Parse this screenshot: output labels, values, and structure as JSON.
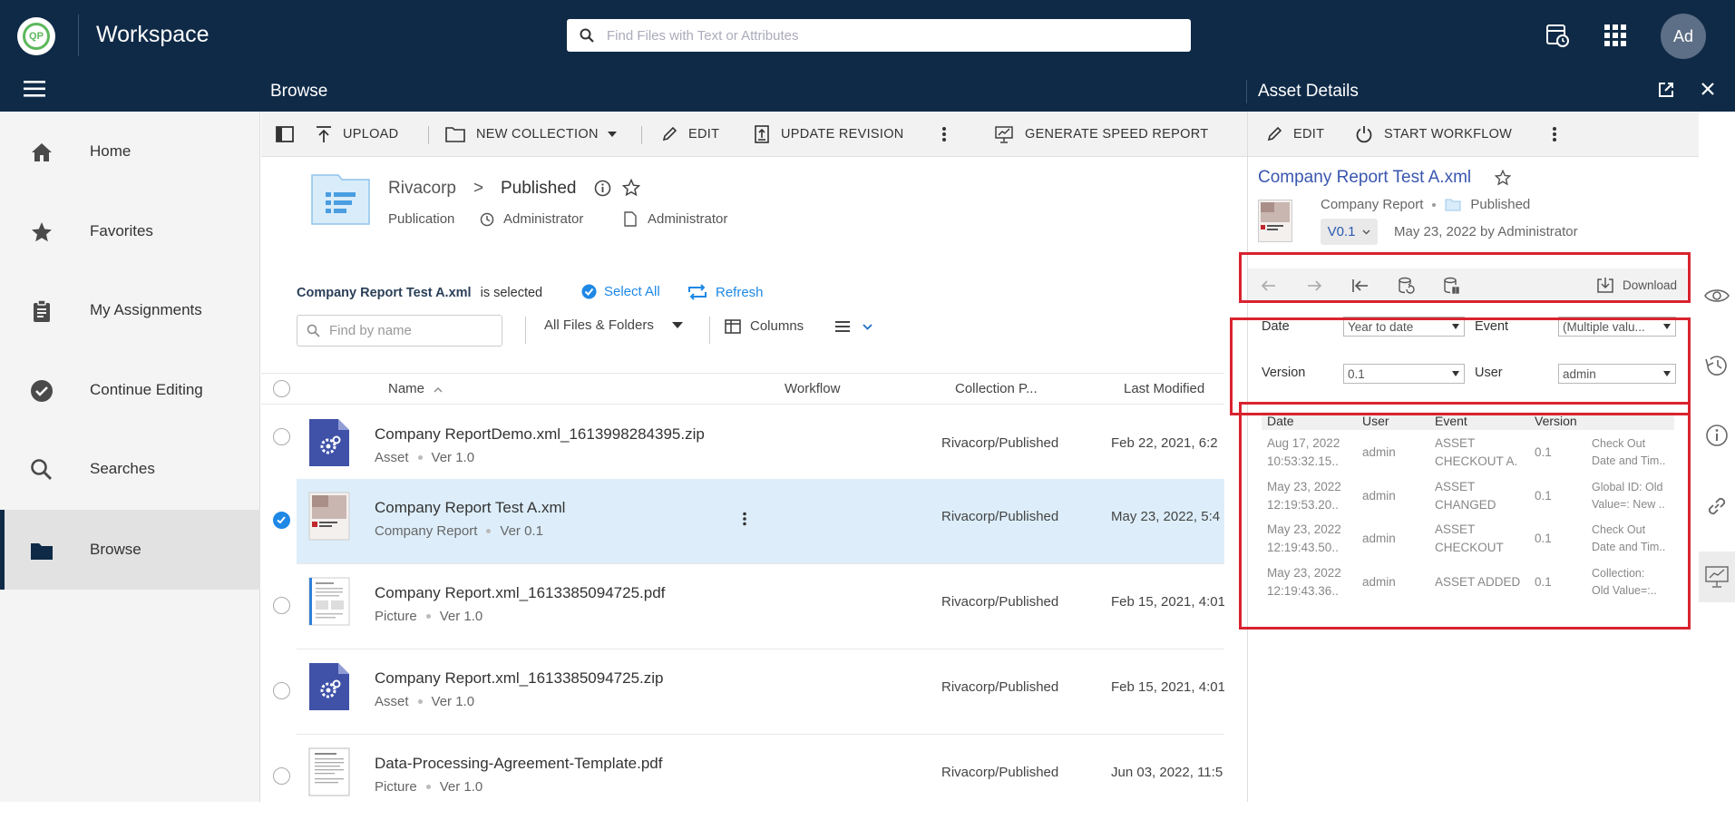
{
  "header": {
    "logo_text": "QP",
    "app_title": "Workspace",
    "search_placeholder": "Find Files with Text or Attributes",
    "avatar_initials": "Ad"
  },
  "subbar": {
    "title": "Browse",
    "detail_title": "Asset Details"
  },
  "sidebar": {
    "items": [
      {
        "label": "Home",
        "icon": "home-icon"
      },
      {
        "label": "Favorites",
        "icon": "star-icon"
      },
      {
        "label": "My Assignments",
        "icon": "clipboard-icon"
      },
      {
        "label": "Continue Editing",
        "icon": "check-circle-icon"
      },
      {
        "label": "Searches",
        "icon": "search-icon"
      },
      {
        "label": "Browse",
        "icon": "folder-icon",
        "active": true
      }
    ]
  },
  "toolbar": {
    "upload": "UPLOAD",
    "new_collection": "NEW COLLECTION",
    "edit": "EDIT",
    "update_revision": "UPDATE REVISION",
    "generate_speed_report": "GENERATE SPEED REPORT"
  },
  "collection": {
    "parent": "Rivacorp",
    "separator": ">",
    "name": "Published",
    "type": "Publication",
    "owner": "Administrator",
    "creator": "Administrator"
  },
  "selection": {
    "item": "Company Report Test A.xml",
    "suffix": "is selected",
    "select_all": "Select All",
    "refresh": "Refresh"
  },
  "filters": {
    "find_placeholder": "Find by name",
    "scope": "All Files & Folders",
    "columns": "Columns"
  },
  "table": {
    "headers": [
      "Name",
      "Workflow",
      "Collection P...",
      "Last Modified"
    ],
    "rows": [
      {
        "name": "Company ReportDemo.xml_1613998284395.zip",
        "type": "Asset",
        "version": "Ver 1.0",
        "collection": "Rivacorp/Published",
        "modified": "Feb 22, 2021, 6:2",
        "thumb": "gear-file"
      },
      {
        "name": "Company Report Test A.xml",
        "type": "Company Report",
        "version": "Ver 0.1",
        "collection": "Rivacorp/Published",
        "modified": "May 23, 2022, 5:4",
        "thumb": "report",
        "selected": true
      },
      {
        "name": "Company Report.xml_1613385094725.pdf",
        "type": "Picture",
        "version": "Ver 1.0",
        "collection": "Rivacorp/Published",
        "modified": "Feb 15, 2021, 4:01",
        "thumb": "document"
      },
      {
        "name": "Company Report.xml_1613385094725.zip",
        "type": "Asset",
        "version": "Ver 1.0",
        "collection": "Rivacorp/Published",
        "modified": "Feb 15, 2021, 4:01",
        "thumb": "gear-file"
      },
      {
        "name": "Data-Processing-Agreement-Template.pdf",
        "type": "Picture",
        "version": "Ver 1.0",
        "collection": "Rivacorp/Published",
        "modified": "Jun 03, 2022, 11:5",
        "thumb": "document"
      }
    ]
  },
  "details": {
    "edit": "EDIT",
    "start_workflow": "START WORKFLOW",
    "asset_title": "Company Report Test A.xml",
    "asset_type": "Company Report",
    "asset_location": "Published",
    "version_chip": "V0.1",
    "version_date": "May 23, 2022 by Administrator",
    "download": "Download",
    "filters": {
      "date_label": "Date",
      "date_value": "Year to date",
      "event_label": "Event",
      "event_value": "(Multiple valu...",
      "version_label": "Version",
      "version_value": "0.1",
      "user_label": "User",
      "user_value": "admin"
    },
    "history_headers": [
      "Date",
      "User",
      "Event",
      "Version"
    ],
    "history": [
      {
        "date1": "Aug 17, 2022",
        "date2": "10:53:32.15..",
        "user": "admin",
        "event1": "ASSET",
        "event2": "CHECKOUT A..",
        "version": "0.1",
        "detail1": "Check Out",
        "detail2": "Date and Tim.."
      },
      {
        "date1": "May 23, 2022",
        "date2": "12:19:53.20..",
        "user": "admin",
        "event1": "ASSET",
        "event2": "CHANGED",
        "version": "0.1",
        "detail1": "Global ID: Old",
        "detail2": "Value=: New .."
      },
      {
        "date1": "May 23, 2022",
        "date2": "12:19:43.50..",
        "user": "admin",
        "event1": "ASSET",
        "event2": "CHECKOUT",
        "version": "0.1",
        "detail1": "Check Out",
        "detail2": "Date and Tim.."
      },
      {
        "date1": "May 23, 2022",
        "date2": "12:19:43.36..",
        "user": "admin",
        "event1": "ASSET ADDED",
        "event2": "",
        "version": "0.1",
        "detail1": "Collection:",
        "detail2": "Old Value=:.."
      }
    ]
  },
  "colors": {
    "navy": "#0f2a47",
    "accent_blue": "#1e88e5",
    "highlight_red": "#d9232f",
    "selected_row": "#ddeefa"
  }
}
